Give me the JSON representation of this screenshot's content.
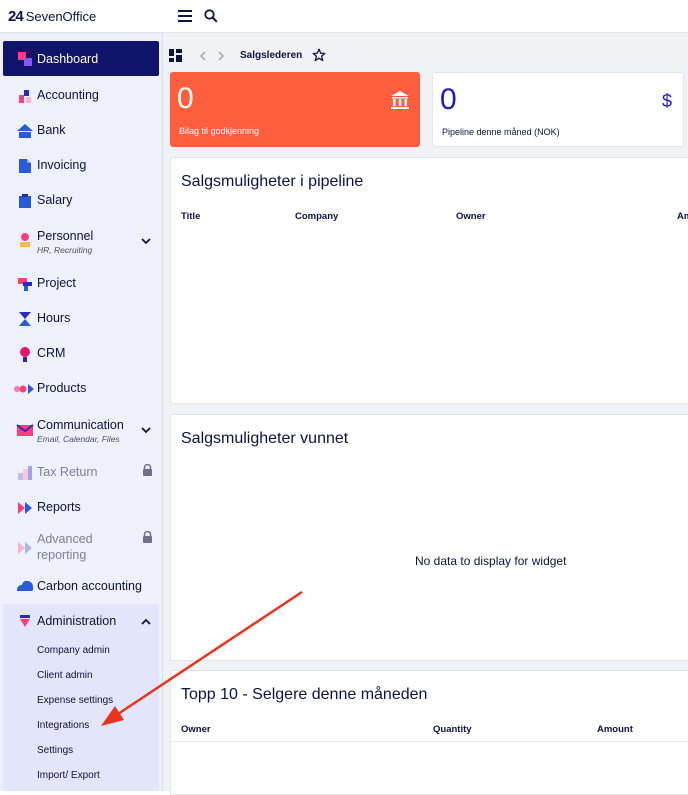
{
  "app": {
    "logo_mark": "24",
    "logo_text": "SevenOffice"
  },
  "topbar": {
    "menu_icon": "hamburger-icon",
    "search_icon": "search-icon"
  },
  "sidebar": {
    "items": [
      {
        "label": "Dashboard"
      },
      {
        "label": "Accounting"
      },
      {
        "label": "Bank"
      },
      {
        "label": "Invoicing"
      },
      {
        "label": "Salary"
      },
      {
        "label": "Personnel",
        "sub": "HR, Recruiting"
      },
      {
        "label": "Project"
      },
      {
        "label": "Hours"
      },
      {
        "label": "CRM"
      },
      {
        "label": "Products"
      },
      {
        "label": "Communication",
        "sub": "Email, Calendar, Files"
      },
      {
        "label": "Tax Return"
      },
      {
        "label": "Reports"
      },
      {
        "label": "Advanced",
        "label2": "reporting"
      },
      {
        "label": "Carbon accounting"
      },
      {
        "label": "Administration"
      }
    ],
    "admin_sub": [
      "Company admin",
      "Client admin",
      "Expense settings",
      "Integrations",
      "Settings",
      "Import/ Export"
    ]
  },
  "breadcrumb": {
    "current": "Salgslederen"
  },
  "kpis": [
    {
      "value": "0",
      "caption": "Bilag til godkjenning",
      "color": "#ff5f3f"
    },
    {
      "value": "0",
      "caption": "Pipeline denne måned (NOK)",
      "symbol": "$"
    }
  ],
  "widgets": {
    "pipeline": {
      "title": "Salgsmuligheter i pipeline",
      "columns": [
        "Title",
        "Company",
        "Owner",
        "Am"
      ]
    },
    "won": {
      "title": "Salgsmuligheter vunnet",
      "empty": "No data to display for widget"
    },
    "top10": {
      "title": "Topp 10 - Selgere denne måneden",
      "columns": [
        "Owner",
        "Quantity",
        "Amount"
      ]
    }
  },
  "colors": {
    "accent": "#10146b",
    "kpi_red": "#ff5f3f",
    "kpi_blue": "#1a1ac8",
    "arrow": "#e8341f"
  }
}
